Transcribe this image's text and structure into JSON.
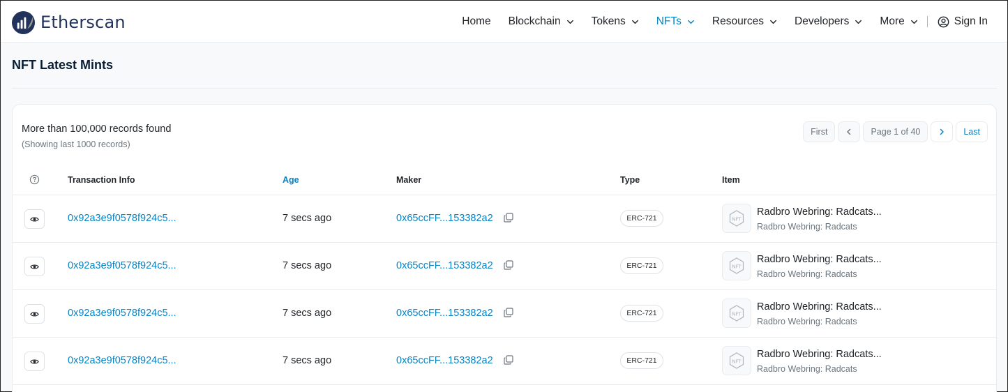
{
  "brand": {
    "name": "Etherscan"
  },
  "nav": {
    "items": [
      {
        "label": "Home",
        "dropdown": false,
        "active": false
      },
      {
        "label": "Blockchain",
        "dropdown": true,
        "active": false
      },
      {
        "label": "Tokens",
        "dropdown": true,
        "active": false
      },
      {
        "label": "NFTs",
        "dropdown": true,
        "active": true
      },
      {
        "label": "Resources",
        "dropdown": true,
        "active": false
      },
      {
        "label": "Developers",
        "dropdown": true,
        "active": false
      },
      {
        "label": "More",
        "dropdown": true,
        "active": false
      }
    ],
    "signin": "Sign In"
  },
  "page": {
    "title": "NFT Latest Mints"
  },
  "summary": {
    "records": "More than 100,000 records found",
    "showing": "(Showing last 1000 records)"
  },
  "pager": {
    "first": "First",
    "page_info": "Page 1 of 40",
    "last": "Last"
  },
  "table": {
    "headers": {
      "tx": "Transaction Info",
      "age": "Age",
      "maker": "Maker",
      "type": "Type",
      "item": "Item"
    },
    "rows": [
      {
        "tx": "0x92a3e9f0578f924c5...",
        "age": "7 secs ago",
        "maker": "0x65ccFF...153382a2",
        "type": "ERC-721",
        "item_name": "Radbro Webring: Radcats...",
        "item_collection": "Radbro Webring: Radcats"
      },
      {
        "tx": "0x92a3e9f0578f924c5...",
        "age": "7 secs ago",
        "maker": "0x65ccFF...153382a2",
        "type": "ERC-721",
        "item_name": "Radbro Webring: Radcats...",
        "item_collection": "Radbro Webring: Radcats"
      },
      {
        "tx": "0x92a3e9f0578f924c5...",
        "age": "7 secs ago",
        "maker": "0x65ccFF...153382a2",
        "type": "ERC-721",
        "item_name": "Radbro Webring: Radcats...",
        "item_collection": "Radbro Webring: Radcats"
      },
      {
        "tx": "0x92a3e9f0578f924c5...",
        "age": "7 secs ago",
        "maker": "0x65ccFF...153382a2",
        "type": "ERC-721",
        "item_name": "Radbro Webring: Radcats...",
        "item_collection": "Radbro Webring: Radcats"
      }
    ]
  },
  "colors": {
    "link": "#0784c3",
    "brand_dark": "#21325b",
    "muted": "#6c757d",
    "border": "#e9ecef"
  }
}
